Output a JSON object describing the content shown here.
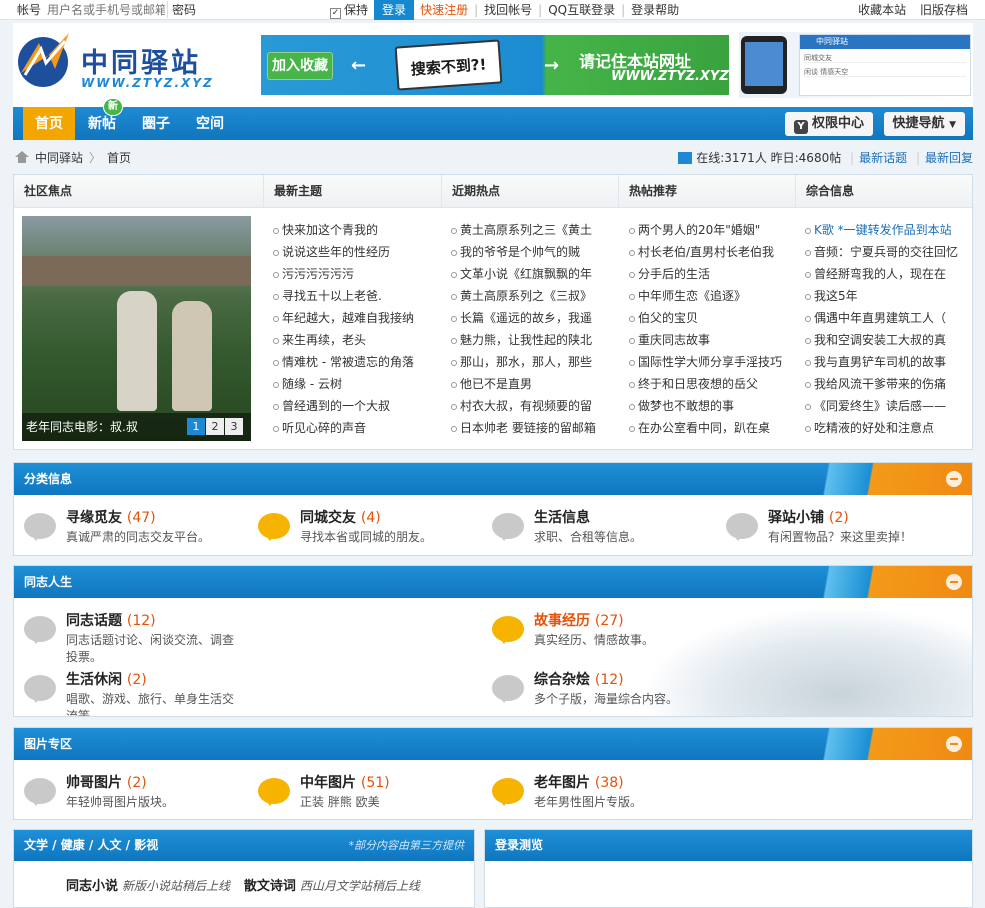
{
  "topbar": {
    "account_label": "帐号",
    "account_placeholder": "用户名或手机号或邮箱",
    "password_label": "密码",
    "remember_label": "保持",
    "login_button": "登录",
    "register_link": "快速注册",
    "find_account_link": "找回帐号",
    "qq_login_link": "QQ互联登录",
    "help_link": "登录帮助",
    "favorite_link": "收藏本站",
    "old_version_link": "旧版存档"
  },
  "header": {
    "logo_title": "中同驿站",
    "logo_subtitle": "WWW.ZTYZ.XYZ",
    "banner_fav": "加入收藏",
    "banner_search": "搜索不到?!",
    "banner_text1": "请记住本站网址",
    "banner_text2": "WWW.ZTYZ.XYZ",
    "phone_bar": "中同驿站",
    "phone_row1": "同城交友",
    "phone_row2": "闲谈  情感天空"
  },
  "nav": {
    "items": [
      "首页",
      "新帖",
      "圈子",
      "空间"
    ],
    "new_badge": "新",
    "right_buttons": [
      "权限中心",
      "快捷导航"
    ]
  },
  "breadcrumb": {
    "site": "中同驿站",
    "current": "首页",
    "stats": "在线:3171人 昨日:4680帖",
    "latest_topics": "最新话题",
    "latest_replies": "最新回复"
  },
  "focus": {
    "columns": [
      "社区焦点",
      "最新主题",
      "近期热点",
      "热帖推荐",
      "综合信息"
    ],
    "photo_caption": "老年同志电影：叔.叔",
    "pages": [
      "1",
      "2",
      "3"
    ],
    "latest": [
      "快来加这个青我的",
      "说说这些年的性经历",
      "污污污污污污",
      "寻找五十以上老爸.",
      "年纪越大，越难自我接纳",
      "来生再续，老头",
      "情难枕 - 常被遗忘的角落",
      "随缘 - 云树",
      "曾经遇到的一个大叔",
      "听见心碎的声音"
    ],
    "hot": [
      "黄土高原系列之三《黄土",
      "我的爷爷是个帅气的贼",
      "文革小说《红旗飘飘的年",
      "黄土高原系列之《三叔》",
      "长篇《遥远的故乡，我遥",
      "魅力熊，让我性起的陕北",
      "那山，那水，那人，那些",
      "他已不是直男",
      "村衣大叔，有视频要的留",
      "日本帅老 要链接的留邮箱"
    ],
    "recommend": [
      "两个男人的20年\"婚姻\"",
      "村长老伯/直男村长老伯我",
      "分手后的生活",
      "中年师生恋《追逐》",
      "伯父的宝贝",
      "重庆同志故事",
      "国际性学大师分享手淫技巧",
      "终于和日思夜想的岳父",
      "做梦也不敢想的事",
      "在办公室看中同，趴在桌"
    ],
    "info": [
      "K歌 *一键转发作品到本站",
      "音频：宁夏兵哥的交往回忆",
      "曾经掰弯我的人，现在在",
      "我这5年",
      "偶遇中年直男建筑工人（",
      "我和空调安装工大叔的真",
      "我与直男铲车司机的故事",
      "我给风流干爹带来的伤痛",
      "《同爱终生》读后感——",
      "吃精液的好处和注意点"
    ]
  },
  "sections": {
    "category": {
      "title": "分类信息",
      "forums": [
        {
          "name": "寻缘觅友",
          "count": "(47)",
          "desc": "真诚严肃的同志交友平台。"
        },
        {
          "name": "同城交友",
          "count": "(4)",
          "desc": "寻找本省或同城的朋友。"
        },
        {
          "name": "生活信息",
          "count": "",
          "desc": "求职、合租等信息。"
        },
        {
          "name": "驿站小铺",
          "count": "(2)",
          "desc": "有闲置物品？来这里卖掉！"
        }
      ]
    },
    "life": {
      "title": "同志人生",
      "forums": [
        {
          "name": "同志话题",
          "count": "(12)",
          "desc": "同志话题讨论、闲谈交流、调查投票。"
        },
        {
          "name": "故事经历",
          "count": "(27)",
          "desc": "真实经历、情感故事。"
        },
        {
          "name": "生活休闲",
          "count": "(2)",
          "desc": "唱歌、游戏、旅行、单身生活交流等。"
        },
        {
          "name": "综合杂烩",
          "count": "(12)",
          "desc": "多个子版，海量综合内容。"
        }
      ]
    },
    "pictures": {
      "title": "图片专区",
      "forums": [
        {
          "name": "帅哥图片",
          "count": "(2)",
          "desc": "年轻帅哥图片版块。"
        },
        {
          "name": "中年图片",
          "count": "(51)",
          "desc": "正装 胖熊 欧美"
        },
        {
          "name": "老年图片",
          "count": "(38)",
          "desc": "老年男性图片专版。"
        }
      ]
    }
  },
  "bottom": {
    "left_title": "文学 / 健康 / 人文 / 影视",
    "left_note": "*部分内容由第三方提供",
    "item1_name": "同志小说",
    "item1_desc": "新版小说站稍后上线",
    "item2_name": "散文诗词",
    "item2_desc": "西山月文学站稍后上线",
    "right_title": "登录测览"
  },
  "colors": {
    "brand_blue": "#1e88d2",
    "accent_orange": "#f4a600",
    "link_red": "#e4520a"
  }
}
